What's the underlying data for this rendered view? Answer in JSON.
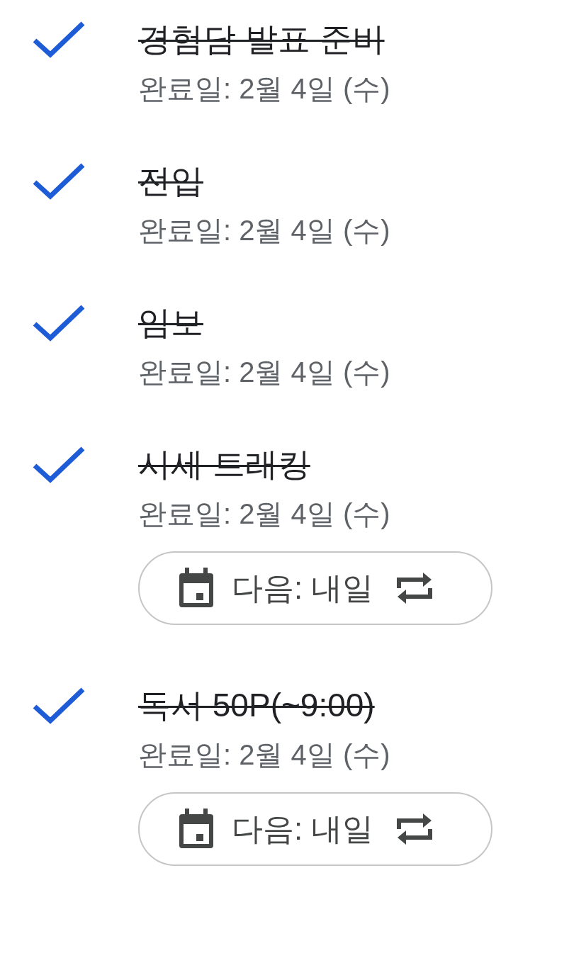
{
  "tasks": [
    {
      "title": "경험담 발표 준비",
      "completed": true,
      "date": "완료일: 2월 4일 (수)"
    },
    {
      "title": "전입",
      "completed": true,
      "date": "완료일: 2월 4일 (수)"
    },
    {
      "title": "임보",
      "completed": true,
      "date": "완료일: 2월 4일 (수)"
    },
    {
      "title": "시세 트래킹",
      "completed": true,
      "date": "완료일: 2월 4일 (수)",
      "repeat_chip": "다음: 내일"
    },
    {
      "title": "독서 50P(~9:00)",
      "completed": true,
      "date": "완료일: 2월 4일 (수)",
      "repeat_chip": "다음: 내일"
    }
  ]
}
